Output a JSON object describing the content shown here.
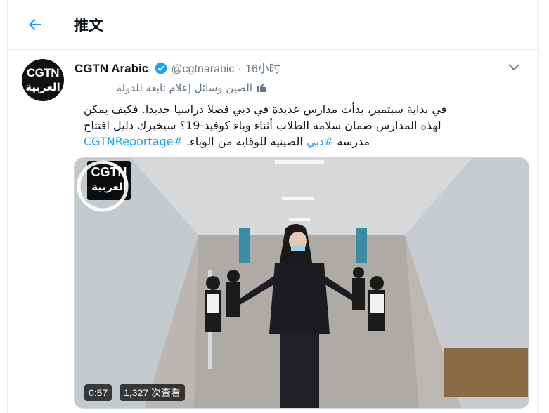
{
  "header": {
    "title": "推文"
  },
  "tweet": {
    "avatar_line1": "CGTN",
    "avatar_line2": "العربية",
    "name": "CGTN Arabic",
    "handle": "@cgtnarabic",
    "separator": "·",
    "time": "16小时",
    "label": "الصين وسائل إعلام تابعة للدولة",
    "text_line1": "في بداية سبتمبر، بدأت مدارس عديدة في دبي فصلا دراسيا جديدا. فكيف يمكن",
    "text_line2": "لهذه المدارس ضمان سلامة الطلاب أثناء وباء كوفيد-19؟ سيخبرك دليل افتتاح",
    "text_line3_a": "مدرسة ",
    "hashtag_dubai": "#دبي",
    "text_line3_b": " الصينية للوقاية من الوباء. ",
    "hashtag_report": "#CGTNReportage"
  },
  "media": {
    "logo_line1": "CGTN",
    "logo_line2": "العربية",
    "duration": "0:57",
    "views": "1,327 次查看"
  },
  "colors": {
    "accent": "#1da1f2",
    "secondary_text": "#657786",
    "border": "#e6ecf0"
  },
  "icons": [
    "back-arrow-icon",
    "verified-badge-icon",
    "chevron-down-icon",
    "state-media-icon",
    "play-icon"
  ]
}
